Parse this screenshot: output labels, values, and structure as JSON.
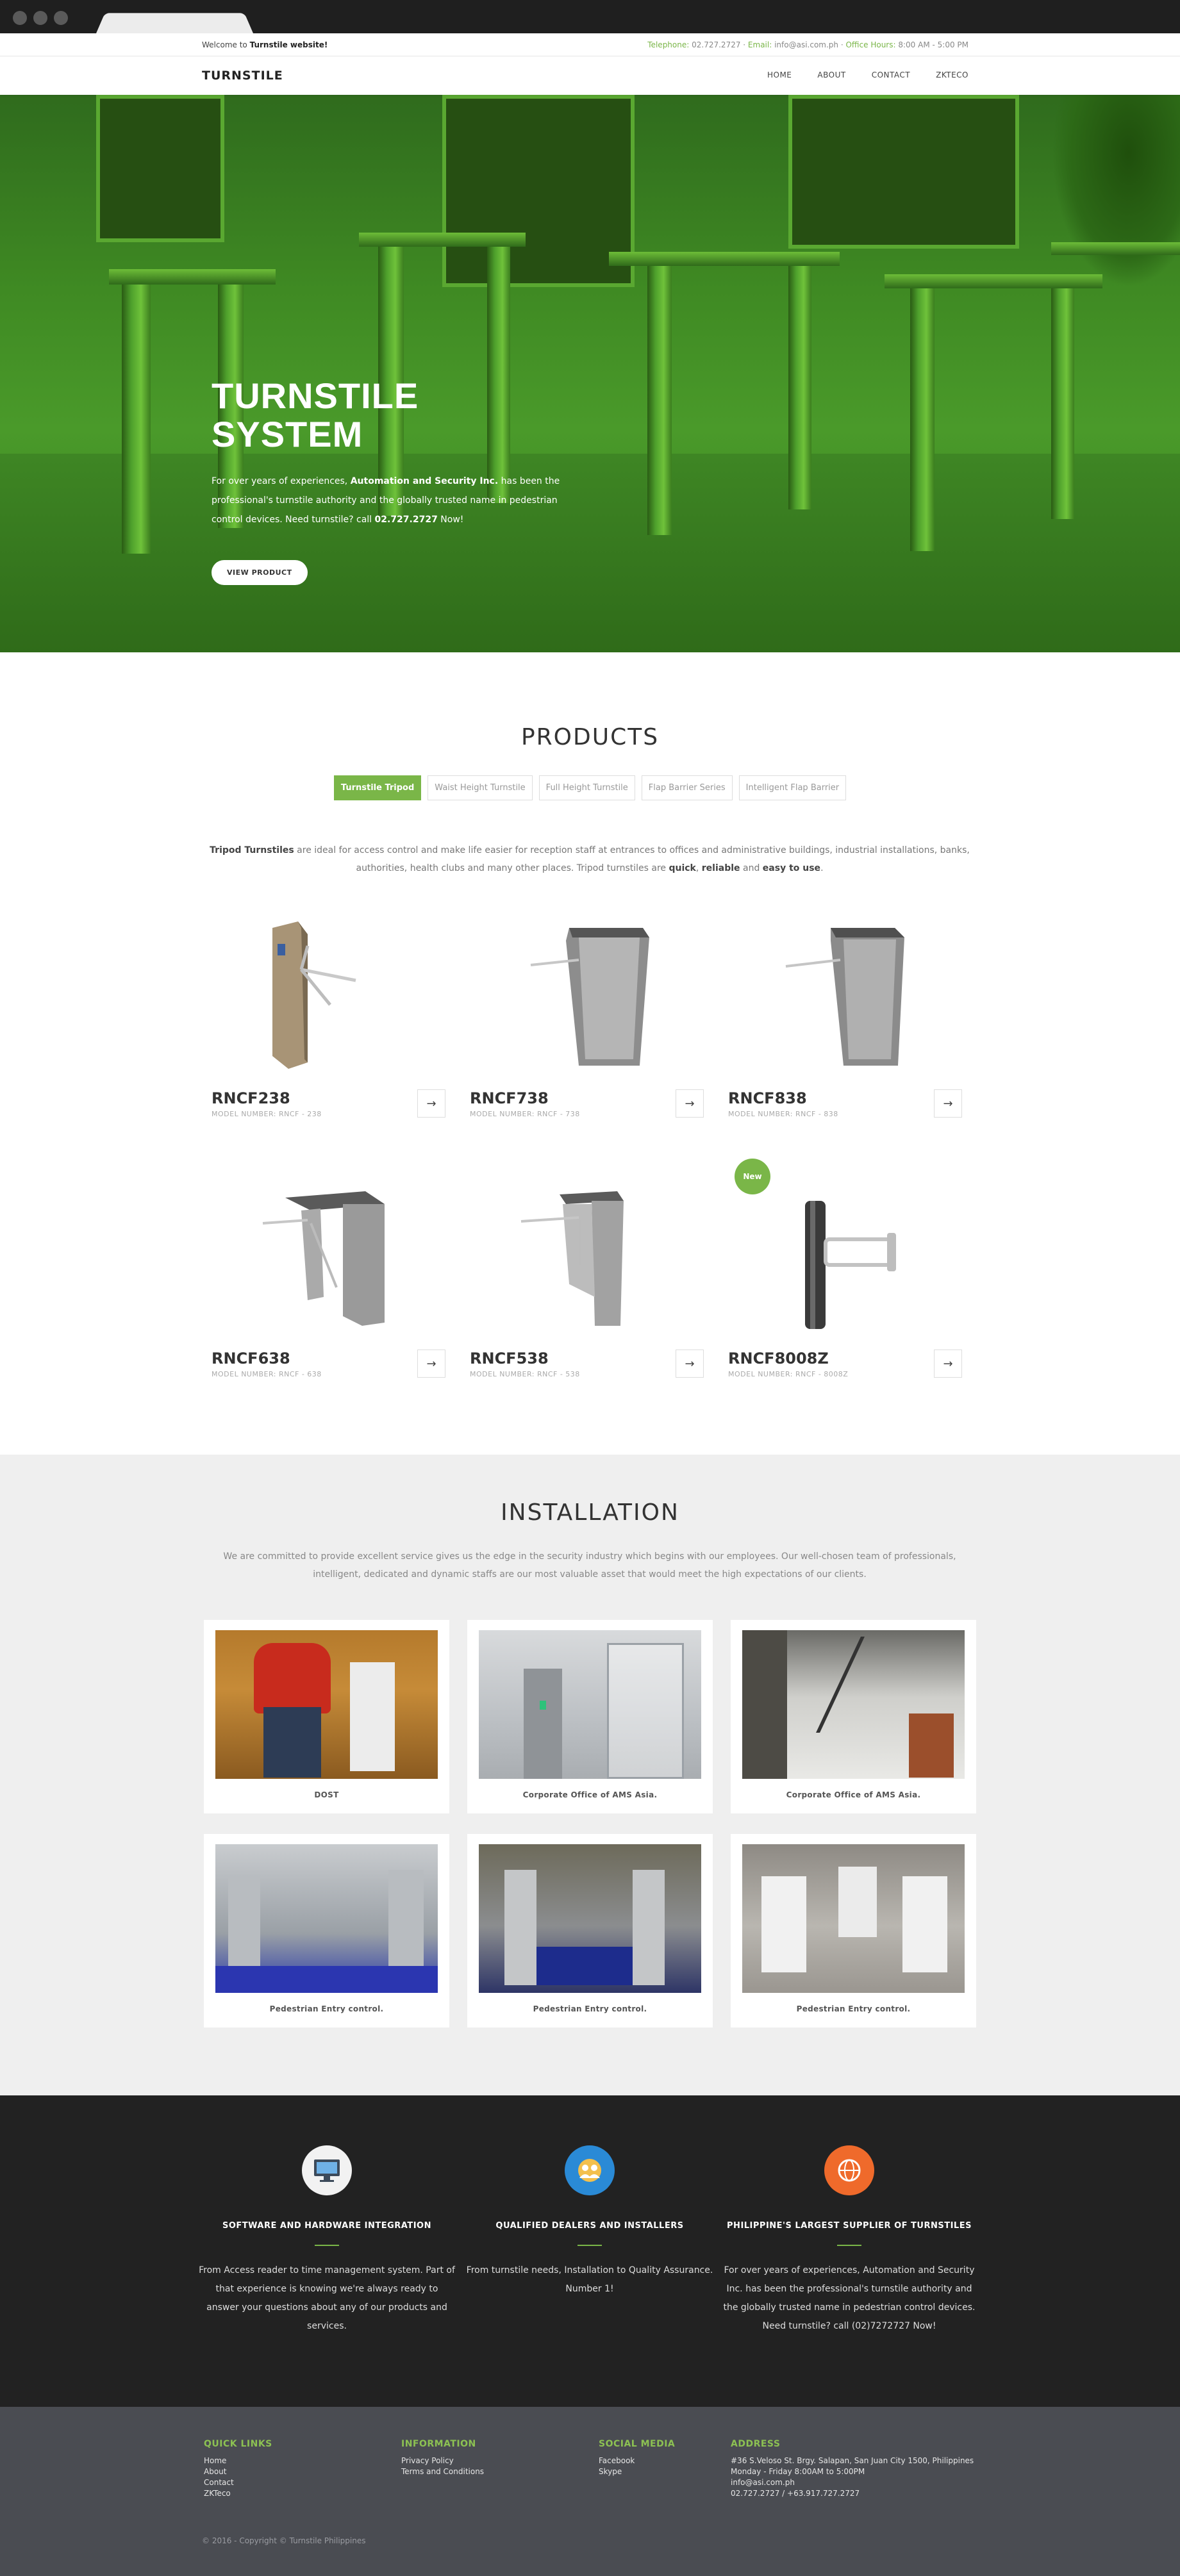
{
  "topbar": {
    "welcome_prefix": "Welcome to",
    "welcome_site": "Turnstile website!",
    "tel_label": "Telephone:",
    "tel_value": "02.727.2727",
    "email_label": "Email:",
    "email_value": "info@asi.com.ph",
    "hours_label": "Office Hours:",
    "hours_value": "8:00 AM - 5:00 PM"
  },
  "nav": {
    "logo": "TURNSTILE",
    "items": [
      "HOME",
      "ABOUT",
      "CONTACT",
      "ZKTECO"
    ]
  },
  "hero": {
    "title_line1": "TURNSTILE",
    "title_line2": "SYSTEM",
    "text_1": "For over years of experiences,",
    "text_company": "Automation and Security Inc.",
    "text_2": "has been the professional's turnstile authority and the globally trusted name in pedestrian control devices. Need turnstile? call",
    "text_phone": "02.727.2727",
    "text_3": "Now!",
    "button": "VIEW PRODUCT"
  },
  "products": {
    "title": "PRODUCTS",
    "tabs": [
      "Turnstile Tripod",
      "Waist Height Turnstile",
      "Full Height Turnstile",
      "Flap Barrier Series",
      "Intelligent Flap Barrier"
    ],
    "desc_bold": "Tripod Turnstiles",
    "desc_text": "are ideal for access control and make life easier for reception staff at entrances to offices and administrative buildings, industrial installations, banks, authorities, health clubs and many other places. Tripod turnstiles are",
    "desc_quick": "quick",
    "desc_reliable": "reliable",
    "desc_and": "and",
    "desc_easy": "easy to use",
    "items": [
      {
        "name": "RNCF238",
        "model": "MODEL NUMBER: RNCF - 238"
      },
      {
        "name": "RNCF738",
        "model": "MODEL NUMBER: RNCF - 738"
      },
      {
        "name": "RNCF838",
        "model": "MODEL NUMBER: RNCF - 838"
      },
      {
        "name": "RNCF638",
        "model": "MODEL NUMBER: RNCF - 638"
      },
      {
        "name": "RNCF538",
        "model": "MODEL NUMBER: RNCF - 538"
      },
      {
        "name": "RNCF8008Z",
        "model": "MODEL NUMBER: RNCF - 8008Z",
        "badge": "New"
      }
    ],
    "arrow": "→"
  },
  "installation": {
    "title": "INSTALLATION",
    "desc": "We are committed to provide excellent service gives us the edge in the security industry which begins with our employees. Our well-chosen team of professionals, intelligent, dedicated and dynamic staffs are our most valuable asset that would meet the high expectations of our clients.",
    "cards": [
      {
        "caption": "DOST"
      },
      {
        "caption": "Corporate Office of AMS Asia."
      },
      {
        "caption": "Corporate Office of AMS Asia."
      },
      {
        "caption": "Pedestrian Entry control."
      },
      {
        "caption": "Pedestrian Entry control."
      },
      {
        "caption": "Pedestrian Entry control."
      }
    ]
  },
  "features": [
    {
      "icon": "computer-icon",
      "title": "SOFTWARE AND HARDWARE INTEGRATION",
      "text": "From Access reader to time management system. Part of that experience is knowing we're always ready to answer your questions about any of our products and services.",
      "color": "#f2f2f2"
    },
    {
      "icon": "team-icon",
      "title": "QUALIFIED DEALERS AND INSTALLERS",
      "text": "From turnstile needs, Installation to Quality Assurance. Number 1!",
      "color": "#2a8ad6"
    },
    {
      "icon": "globe-icon",
      "title": "PHILIPPINE'S LARGEST SUPPLIER OF TURNSTILES",
      "text": "For over years of experiences, Automation and Security Inc. has been the professional's turnstile authority and the globally trusted name in pedestrian control devices. Need turnstile? call (02)7272727 Now!",
      "color": "#ef6a2b"
    }
  ],
  "footer": {
    "quick_links": {
      "heading": "QUICK LINKS",
      "items": [
        "Home",
        "About",
        "Contact",
        "ZKTeco"
      ]
    },
    "information": {
      "heading": "INFORMATION",
      "items": [
        "Privacy Policy",
        "Terms and Conditions"
      ]
    },
    "social": {
      "heading": "SOCIAL MEDIA",
      "items": [
        "Facebook",
        "Skype"
      ]
    },
    "address": {
      "heading": "ADDRESS",
      "lines": [
        "#36 S.Veloso St. Brgy. Salapan, San Juan City 1500, Philippines",
        "Monday - Friday 8:00AM to 5:00PM",
        "info@asi.com.ph",
        "02.727.2727 / +63.917.727.2727"
      ]
    },
    "copyright": "© 2016 - Copyright © Turnstile Philippines"
  },
  "colors": {
    "accent": "#7ab648",
    "dark": "#222222",
    "footer": "#4a4c52"
  }
}
